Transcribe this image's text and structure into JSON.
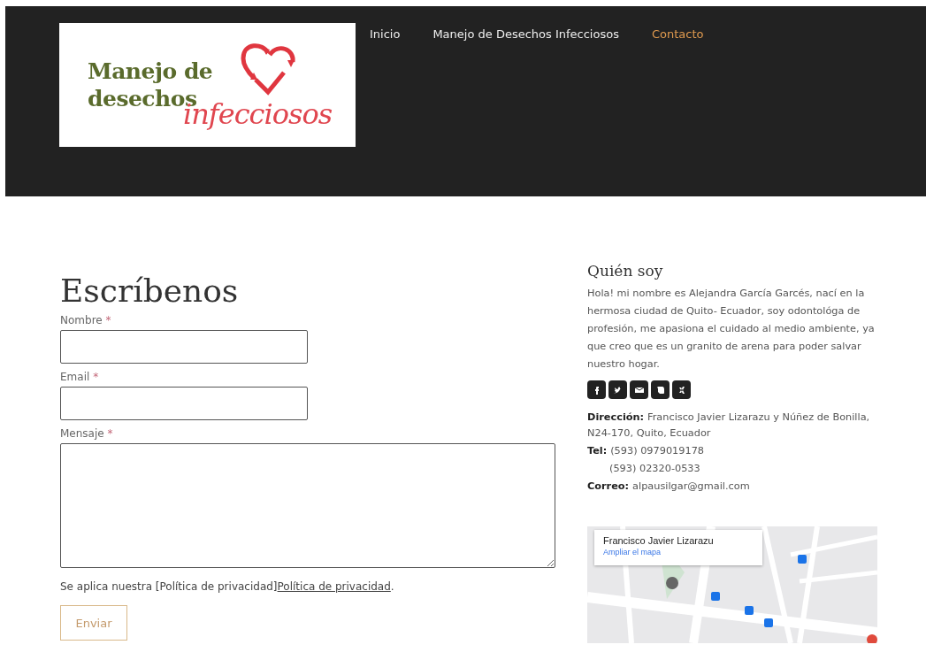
{
  "logo": {
    "line_1": "Manejo de",
    "line_2": "desechos",
    "script": "infecciosos"
  },
  "nav": [
    {
      "label": "Inicio",
      "selected": false
    },
    {
      "label": "Manejo de Desechos Infecciosos",
      "selected": false
    },
    {
      "label": "Contacto",
      "selected": true
    }
  ],
  "form": {
    "title": "Escríbenos",
    "fields": [
      {
        "label": "Nombre",
        "required_mark": "*",
        "kind": "input"
      },
      {
        "label": "Email",
        "required_mark": "*",
        "kind": "input"
      },
      {
        "label": "Mensaje",
        "required_mark": "*",
        "kind": "textarea"
      }
    ],
    "privacy_text": "Se aplica nuestra [Política de privacidad]",
    "privacy_link": "Política de privacidad",
    "privacy_end": ".",
    "submit": "Enviar"
  },
  "sidebar": {
    "title": "Quién soy",
    "bio": "Hola! mi nombre es Alejandra García Garcés, nací en la hermosa ciudad de Quito- Ecuador, soy odontológa de profesión, me apasiona el cuidado al medio ambiente, ya que creo que es un granito de arena para poder salvar nuestro hogar.",
    "social": [
      {
        "kind": "facebook"
      },
      {
        "kind": "twitter"
      },
      {
        "kind": "email"
      },
      {
        "kind": "evernote"
      },
      {
        "kind": "xing"
      }
    ],
    "contact": [
      {
        "label": "Dirección:",
        "value": "Francisco Javier Lizarazu y Núñez de Bonilla, N24-170, Quito, Ecuador"
      },
      {
        "label": "Tel:",
        "value": "(593) 0979019178"
      },
      {
        "value": "(593) 02320-0533"
      },
      {
        "label": "Correo:",
        "value": "alpausilgar@gmail.com"
      }
    ],
    "map": {
      "place": "Francisco Javier Lizarazu",
      "link": "Ampliar el mapa"
    }
  }
}
